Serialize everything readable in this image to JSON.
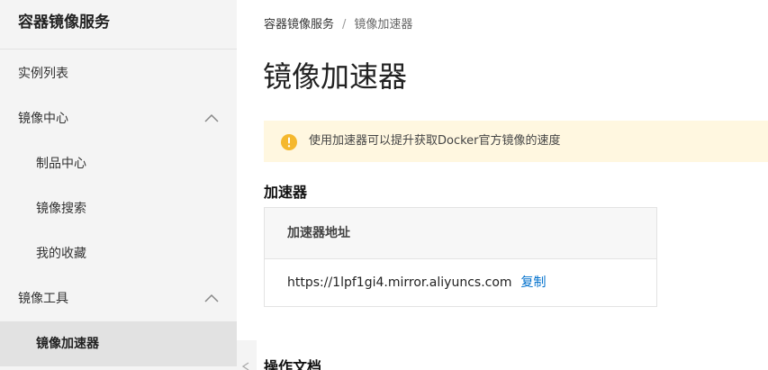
{
  "sidebar": {
    "title": "容器镜像服务",
    "items": [
      {
        "label": "实例列表"
      },
      {
        "label": "镜像中心"
      },
      {
        "label": "制品中心"
      },
      {
        "label": "镜像搜索"
      },
      {
        "label": "我的收藏"
      },
      {
        "label": "镜像工具"
      },
      {
        "label": "镜像加速器"
      }
    ]
  },
  "breadcrumb": {
    "root": "容器镜像服务",
    "separator": "/",
    "current": "镜像加速器"
  },
  "page": {
    "title": "镜像加速器"
  },
  "notice": {
    "text": "使用加速器可以提升获取Docker官方镜像的速度",
    "icon": "warning-icon",
    "color": "#f5b82e"
  },
  "accelerator": {
    "section_title": "加速器",
    "header": "加速器地址",
    "url": "https://1lpf1gi4.mirror.aliyuncs.com",
    "copy_label": "复制"
  },
  "docs": {
    "section_title": "操作文档"
  },
  "colors": {
    "accent": "#0070cc",
    "sidebar_bg": "#f4f4f4",
    "notice_bg": "#fff7e0"
  }
}
